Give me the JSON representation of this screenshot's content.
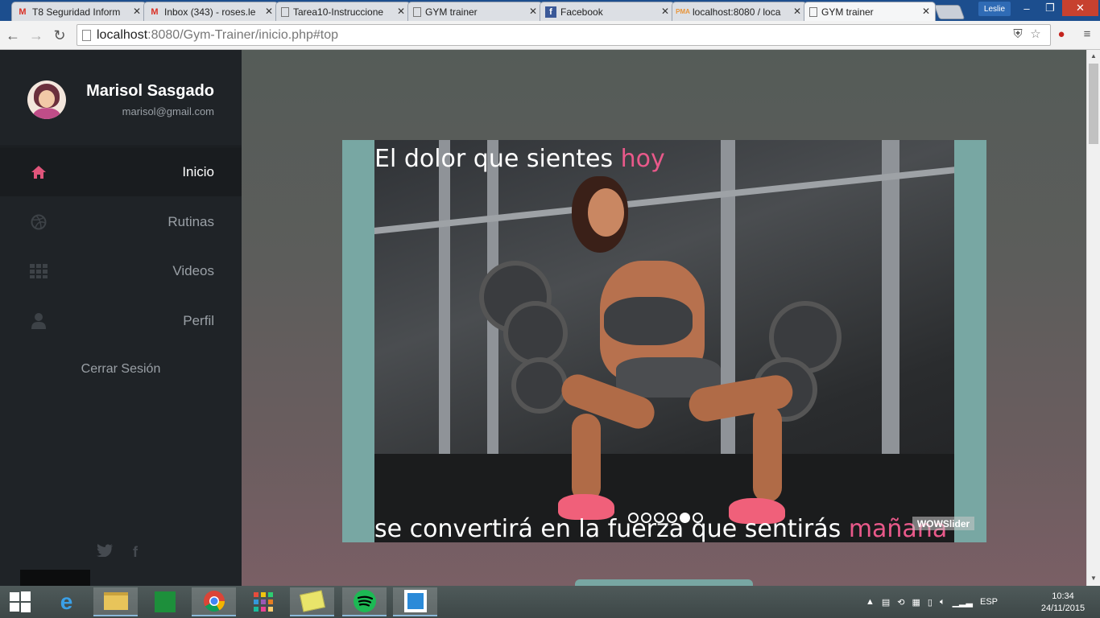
{
  "browser": {
    "tabs": [
      {
        "title": "T8 Seguridad Inform",
        "favicon": "gmail-icon"
      },
      {
        "title": "Inbox (343) - roses.le",
        "favicon": "gmail-icon"
      },
      {
        "title": "Tarea10-Instruccione",
        "favicon": "document-icon"
      },
      {
        "title": "GYM trainer",
        "favicon": "document-icon"
      },
      {
        "title": "Facebook",
        "favicon": "facebook-icon"
      },
      {
        "title": "localhost:8080 / loca",
        "favicon": "phpmyadmin-icon"
      },
      {
        "title": "GYM trainer",
        "favicon": "document-icon",
        "active": true
      }
    ],
    "profile_user": "Leslie",
    "url_host": "localhost",
    "url_rest": ":8080/Gym-Trainer/inicio.php#top"
  },
  "sidebar": {
    "user_name": "Marisol Sasgado",
    "user_email": "marisol@gmail.com",
    "items": [
      {
        "label": "Inicio",
        "icon": "home-icon",
        "active": true
      },
      {
        "label": "Rutinas",
        "icon": "dribbble-icon"
      },
      {
        "label": "Videos",
        "icon": "grid-icon"
      },
      {
        "label": "Perfil",
        "icon": "user-icon"
      }
    ],
    "logout_label": "Cerrar Sesión",
    "social": [
      "twitter-icon",
      "facebook-icon"
    ]
  },
  "slider": {
    "caption_top_main": "El dolor que sientes ",
    "caption_top_highlight": "hoy",
    "caption_bottom_main": "se convertirá en la fuerza que sentirás ",
    "caption_bottom_highlight": "mañana",
    "slide_count": 6,
    "active_slide": 5,
    "watermark": "WOWSlider",
    "colors": {
      "frame": "#78a7a3",
      "highlight": "#e9598a"
    }
  },
  "taskbar": {
    "apps": [
      "windows-start-icon",
      "internet-explorer-icon",
      "file-explorer-icon",
      "store-icon",
      "chrome-icon",
      "apps-icon",
      "sticky-notes-icon",
      "spotify-icon",
      "brackets-icon"
    ],
    "language": "ESP",
    "time": "10:34",
    "date": "24/11/2015"
  }
}
